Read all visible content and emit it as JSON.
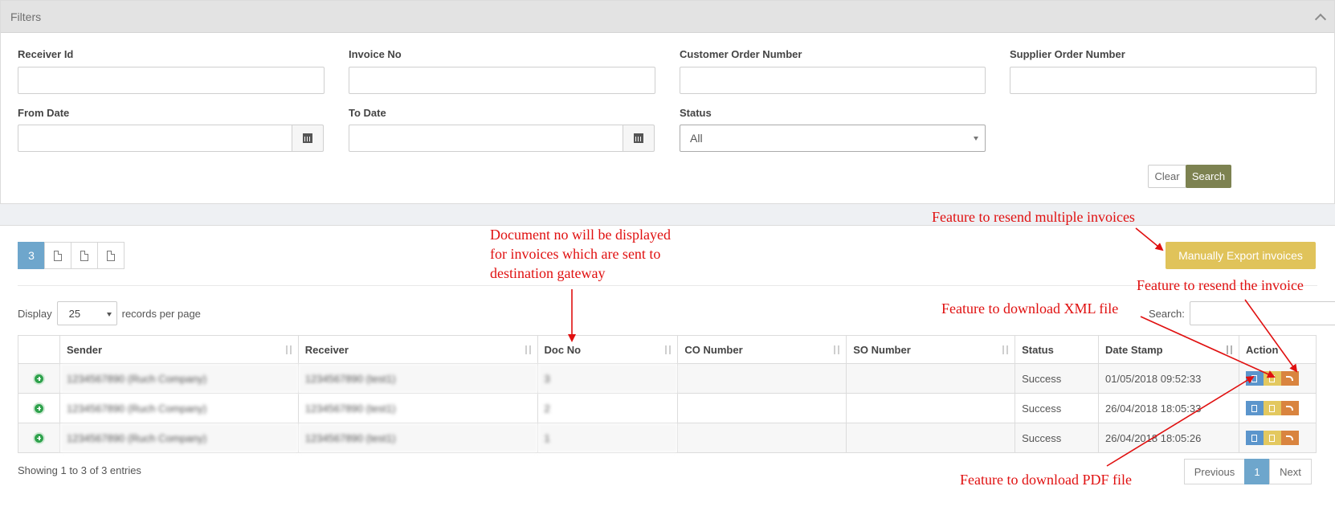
{
  "filters": {
    "title": "Filters",
    "receiver_id_label": "Receiver Id",
    "invoice_no_label": "Invoice No",
    "customer_order_label": "Customer Order Number",
    "supplier_order_label": "Supplier Order Number",
    "from_date_label": "From Date",
    "to_date_label": "To Date",
    "status_label": "Status",
    "status_value": "All",
    "clear_label": "Clear",
    "search_label": "Search"
  },
  "results": {
    "record_count": "3",
    "export_label": "Manually Export invoices",
    "display_label": "Display",
    "page_size": "25",
    "records_per_page_label": "records per page",
    "search_label": "Search:",
    "columns": [
      "Sender",
      "Receiver",
      "Doc No",
      "CO Number",
      "SO Number",
      "Status",
      "Date Stamp",
      "Action"
    ],
    "rows": [
      {
        "sender": "1234567890 (Ruch Company)",
        "receiver": "1234567890 (test1)",
        "doc_no": "3",
        "co_number": "",
        "so_number": "",
        "status": "Success",
        "date_stamp": "01/05/2018 09:52:33"
      },
      {
        "sender": "1234567890 (Ruch Company)",
        "receiver": "1234567890 (test1)",
        "doc_no": "2",
        "co_number": "",
        "so_number": "",
        "status": "Success",
        "date_stamp": "26/04/2018 18:05:33"
      },
      {
        "sender": "1234567890 (Ruch Company)",
        "receiver": "1234567890 (test1)",
        "doc_no": "1",
        "co_number": "",
        "so_number": "",
        "status": "Success",
        "date_stamp": "26/04/2018 18:05:26"
      }
    ],
    "showing_text": "Showing 1 to 3 of 3 entries",
    "prev_label": "Previous",
    "current_page": "1",
    "next_label": "Next"
  },
  "annotations": {
    "doc_no_note": [
      "Document no will be displayed",
      "for invoices which are sent to",
      "destination gateway"
    ],
    "resend_multiple": "Feature to resend multiple invoices",
    "resend_invoice": "Feature to resend the invoice",
    "download_xml": "Feature to download XML file",
    "download_pdf": "Feature to download PDF file"
  },
  "colors": {
    "accent_blue": "#6ea6cc",
    "search_button": "#7d8251",
    "export_button": "#e0c35a",
    "pdf_action": "#5b95cc",
    "xml_action": "#e3c85f",
    "resend_action": "#d9843f",
    "annotation": "#e01010"
  }
}
